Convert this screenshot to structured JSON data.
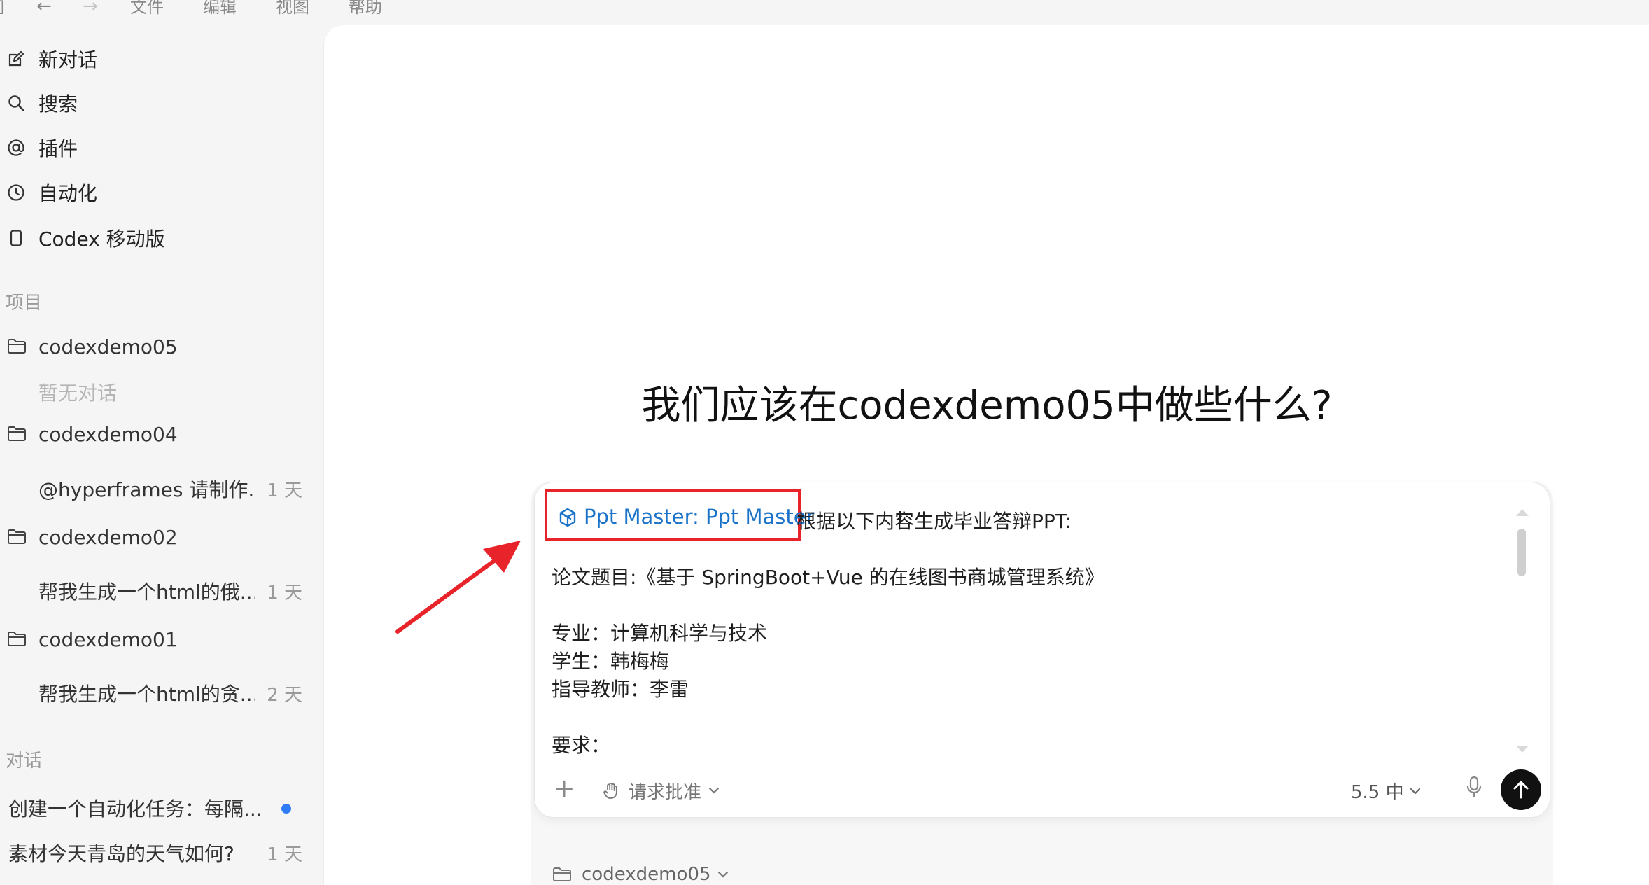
{
  "menubar": {
    "items": [
      "文件",
      "编辑",
      "视图",
      "帮助"
    ]
  },
  "sidebar": {
    "nav": [
      {
        "label": "新对话",
        "icon": "edit-icon"
      },
      {
        "label": "搜索",
        "icon": "search-icon"
      },
      {
        "label": "插件",
        "icon": "at-icon"
      },
      {
        "label": "自动化",
        "icon": "clock-icon"
      },
      {
        "label": "Codex 移动版",
        "icon": "phone-icon"
      }
    ],
    "projects_label": "项目",
    "projects": [
      {
        "name": "codexdemo05",
        "empty_text": "暂无对话"
      },
      {
        "name": "codexdemo04",
        "thread": "@hyperframes 请制作...",
        "age": "1 天"
      },
      {
        "name": "codexdemo02",
        "thread": "帮我生成一个html的俄...",
        "age": "1 天"
      },
      {
        "name": "codexdemo01",
        "thread": "帮我生成一个html的贪...",
        "age": "2 天"
      }
    ],
    "conversations_label": "对话",
    "conversations": [
      {
        "title": "创建一个自动化任务：每隔...",
        "unread": true
      },
      {
        "title": "素材今天青岛的天气如何?",
        "age": "1 天"
      }
    ]
  },
  "main": {
    "headline": "我们应该在codexdemo05中做些什么?",
    "composer": {
      "skill_chip": "Ppt Master: Ppt Master",
      "first_line_rest": "根据以下内容生成毕业答辩PPT:",
      "lines": [
        "论文题目:《基于 SpringBoot+Vue 的在线图书商城管理系统》",
        "专业：计算机科学与技术",
        "学生：韩梅梅",
        "指导教师：李雷",
        "要求："
      ],
      "approval_label": "请求批准",
      "model_label": "5.5 中",
      "accent_color": "#1a73c9",
      "highlight_color": "#e8232a"
    },
    "workspace": "codexdemo05"
  }
}
